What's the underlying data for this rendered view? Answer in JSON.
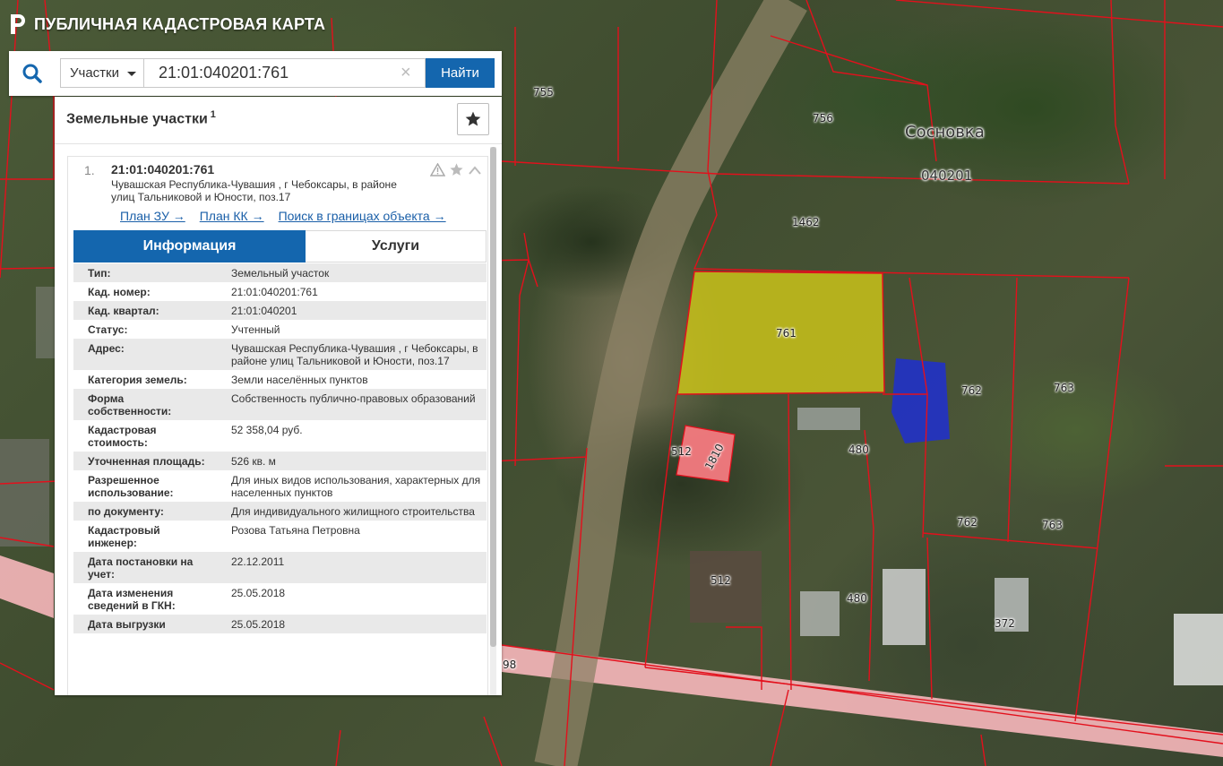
{
  "app": {
    "title": "ПУБЛИЧНАЯ КАДАСТРОВАЯ КАРТА"
  },
  "search": {
    "type_label": "Участки",
    "query": "21:01:040201:761",
    "clear_glyph": "×",
    "button_label": "Найти"
  },
  "panel": {
    "title": "Земельные участки",
    "count": "1",
    "result": {
      "index": "1.",
      "number": "21:01:040201:761",
      "address": "Чувашская Республика-Чувашия , г Чебоксары, в районе улиц Тальниковой и Юности, поз.17",
      "links": [
        "План ЗУ →",
        "План КК →",
        "Поиск в границах объекта →"
      ],
      "tabs": [
        "Информация",
        "Услуги"
      ],
      "fields": [
        {
          "label": "Тип:",
          "value": "Земельный участок"
        },
        {
          "label": "Кад. номер:",
          "value": "21:01:040201:761",
          "link": true
        },
        {
          "label": "Кад. квартал:",
          "value": "21:01:040201",
          "link": true
        },
        {
          "label": "Статус:",
          "value": "Учтенный"
        },
        {
          "label": "Адрес:",
          "value": "Чувашская Республика-Чувашия , г Чебоксары, в районе улиц Тальниковой и Юности, поз.17"
        },
        {
          "label": "Категория земель:",
          "value": "Земли населённых пунктов"
        },
        {
          "label": "Форма собственности:",
          "value": "Собственность публично-правовых образований"
        },
        {
          "label": "Кадастровая стоимость:",
          "value": "52 358,04 руб."
        },
        {
          "label": "Уточненная площадь:",
          "value": "526 кв. м"
        },
        {
          "label": "Разрешенное использование:",
          "value": "Для иных видов использования, характерных для населенных пунктов"
        },
        {
          "label": "по документу:",
          "value": "Для индивидуального жилищного строительства"
        },
        {
          "label": "Кадастровый инженер:",
          "value": "Розова Татьяна Петровна"
        },
        {
          "label": "Дата постановки на учет:",
          "value": "22.12.2011"
        },
        {
          "label": "Дата изменения сведений в ГКН:",
          "value": "25.05.2018"
        },
        {
          "label": "Дата выгрузки",
          "value": "25.05.2018"
        }
      ]
    }
  },
  "map": {
    "locality": "Сосновка",
    "block": "040201",
    "labels": [
      "755",
      "756",
      "1462",
      "761",
      "762",
      "763",
      "512",
      "1810",
      "480",
      "762",
      "763",
      "512",
      "480",
      "372",
      "98"
    ],
    "colors": {
      "boundary": "#e3101c",
      "selected_fill": "#c9c21a",
      "pink_fill": "#f47a80",
      "road": "#f7b7bb"
    }
  }
}
